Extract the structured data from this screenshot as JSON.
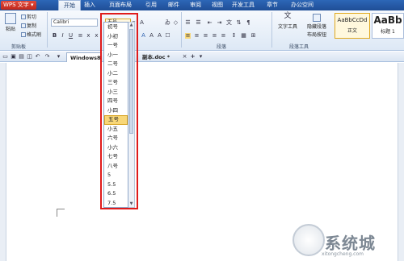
{
  "app": {
    "name": "WPS 文字"
  },
  "menu": {
    "items": [
      "开始",
      "插入",
      "页面布局",
      "引用",
      "邮件",
      "审阅",
      "视图",
      "开发工具",
      "章节",
      "办公空间"
    ],
    "active": "开始"
  },
  "ribbon": {
    "paste": "粘贴",
    "cut": "剪切",
    "copy": "复制",
    "format_painter": "格式刷",
    "clipboard_group": "剪贴板",
    "font_name": "Calibri",
    "font_size": "五号",
    "paragraph_group": "段落",
    "text_tools": "文字工具",
    "hide_marks": "隐藏段落",
    "layout_button": "布局按钮",
    "paragraph_tools_group": "段落工具",
    "style_normal_sample": "AaBbCcDd",
    "style_normal_label": "正文",
    "style_heading_sample": "AaBb",
    "style_heading_label": "标题 1"
  },
  "toolbar2": {
    "tab_windows": "Windows8",
    "tab_copy": "副本.doc *",
    "new_tab": "+"
  },
  "font_size_dropdown": {
    "options": [
      "初号",
      "小初",
      "一号",
      "小一",
      "二号",
      "小二",
      "三号",
      "小三",
      "四号",
      "小四",
      "五号",
      "小五",
      "六号",
      "小六",
      "七号",
      "八号",
      "5",
      "5.5",
      "6.5",
      "7.5"
    ],
    "selected": "五号"
  },
  "watermark": {
    "brand": "系统城",
    "url": "xitongcheng.com"
  },
  "colors": {
    "menubar": "#2a5fae",
    "app_button": "#d43a2c",
    "highlight_box": "#e01b1b",
    "selected_option": "#f8d778"
  }
}
